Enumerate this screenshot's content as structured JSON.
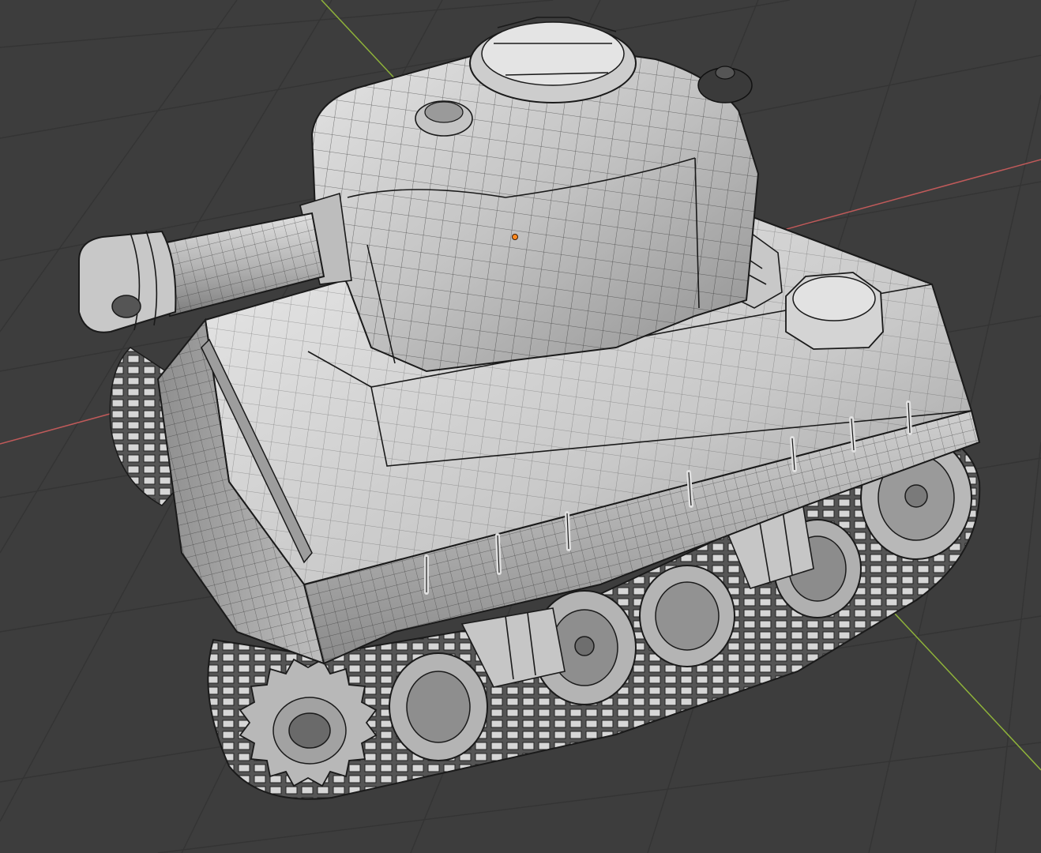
{
  "viewport": {
    "background_color": "#3d3d3d",
    "grid_color": "#343434",
    "x_axis_color": "#c05a5a",
    "y_axis_color": "#8fb33a",
    "origin_marker_color": "#ff8a1f",
    "mesh_base_color": "#b4b4b4",
    "mesh_highlight_color": "#e6e6e6",
    "mesh_shadow_color": "#6e6e6e",
    "wire_color": "#1d1d1d",
    "object": "tank-mesh"
  }
}
